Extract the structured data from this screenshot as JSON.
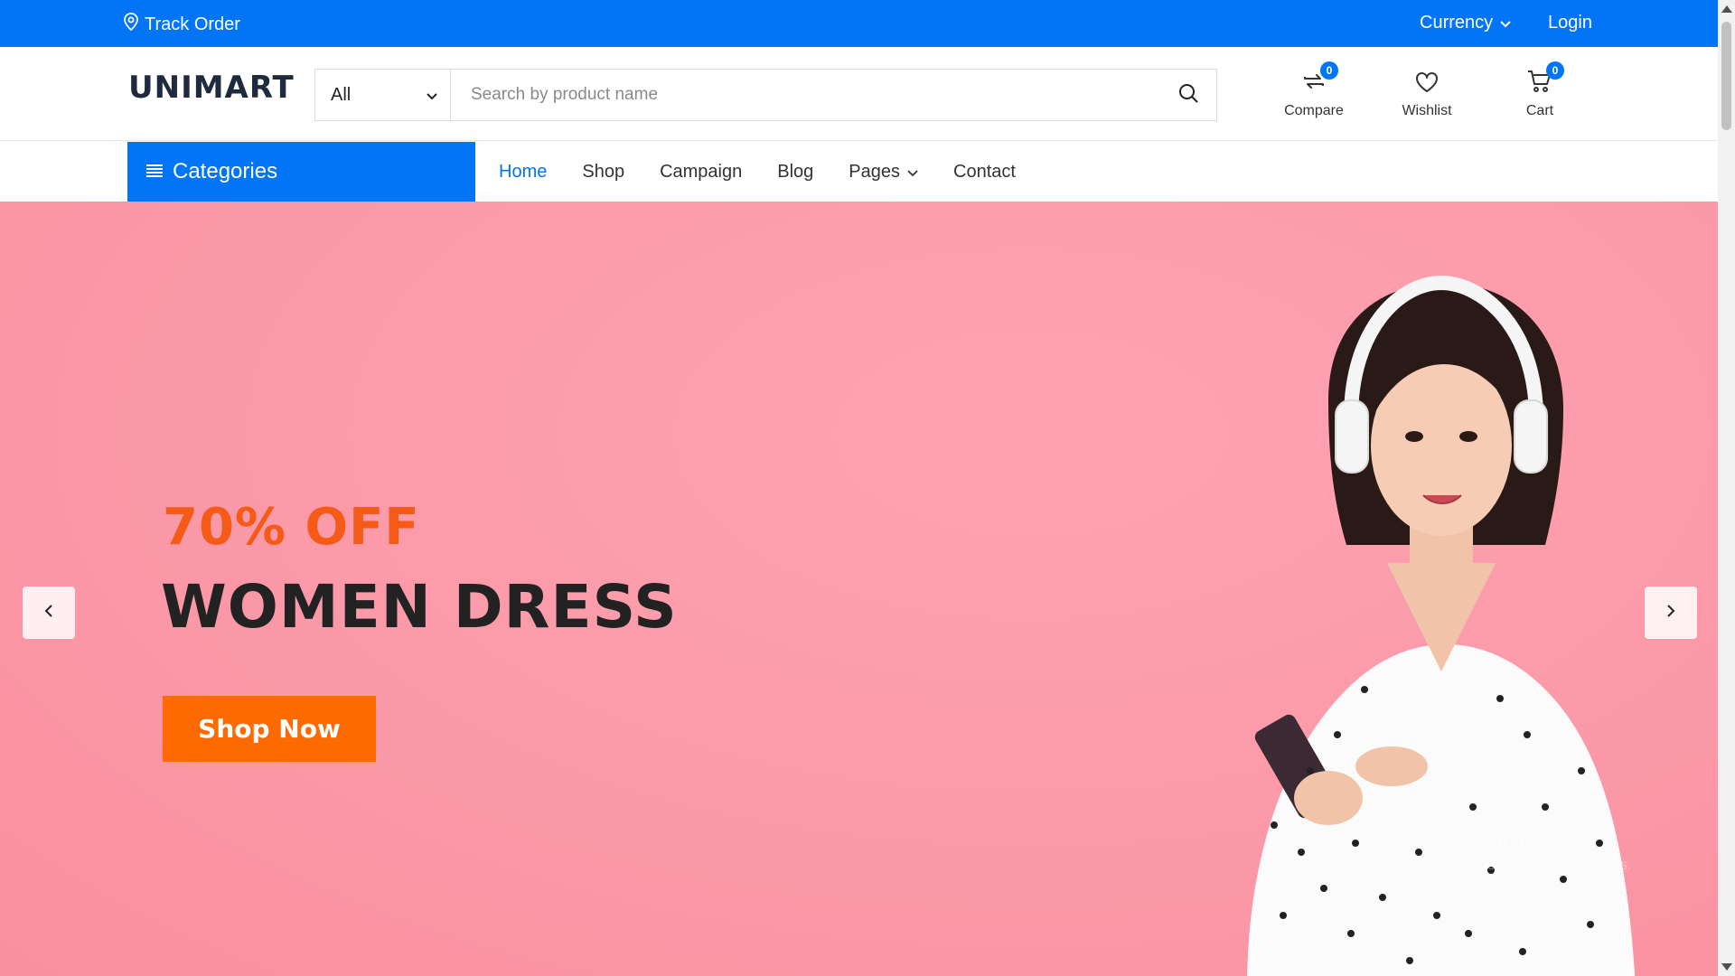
{
  "topbar": {
    "track_order": "Track Order",
    "currency": "Currency",
    "login": "Login"
  },
  "header": {
    "logo_text": "UNIMART",
    "search_category": "All",
    "search_placeholder": "Search by product name",
    "icons": [
      {
        "label": "Compare",
        "badge": "0"
      },
      {
        "label": "Wishlist"
      },
      {
        "label": "Cart",
        "badge": "0"
      }
    ]
  },
  "nav": {
    "categories": "Categories",
    "menu": [
      "Home",
      "Shop",
      "Campaign",
      "Blog",
      "Pages",
      "Contact"
    ],
    "active": "Home"
  },
  "hero": {
    "offer": "70% OFF",
    "title": "WOMEN DRESS",
    "button": "Shop Now"
  },
  "watermark": {
    "line1": "Activate Windows",
    "line2": "Go to Settings to activate Windows."
  },
  "colors": {
    "brand_blue": "#0275f6",
    "accent_orange": "#ff6a00",
    "offer_orange": "#f55a17",
    "hero_pink": "#fc9cab"
  }
}
